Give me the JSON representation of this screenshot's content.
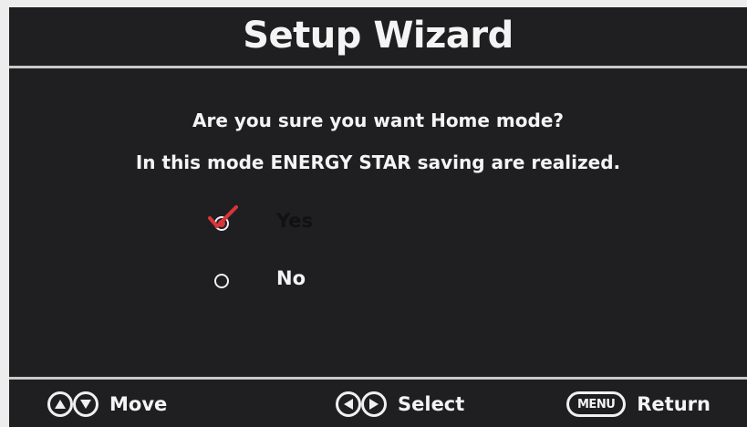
{
  "title": "Setup Wizard",
  "message": {
    "line1": "Are you sure you want Home mode?",
    "line2": "In this mode ENERGY STAR saving are realized."
  },
  "options": [
    {
      "label": "Yes",
      "selected": true
    },
    {
      "label": "No",
      "selected": false
    }
  ],
  "footer": {
    "move_label": "Move",
    "move_icons": [
      "up-arrow-icon",
      "down-arrow-icon"
    ],
    "select_label": "Select",
    "select_icons": [
      "left-arrow-icon",
      "right-arrow-icon"
    ],
    "menu_key": "MENU",
    "return_label": "Return"
  },
  "colors": {
    "background": "#1f1f21",
    "text": "#f4f4f4",
    "divider": "#c9c9c9",
    "check_accent": "#d9343c"
  }
}
